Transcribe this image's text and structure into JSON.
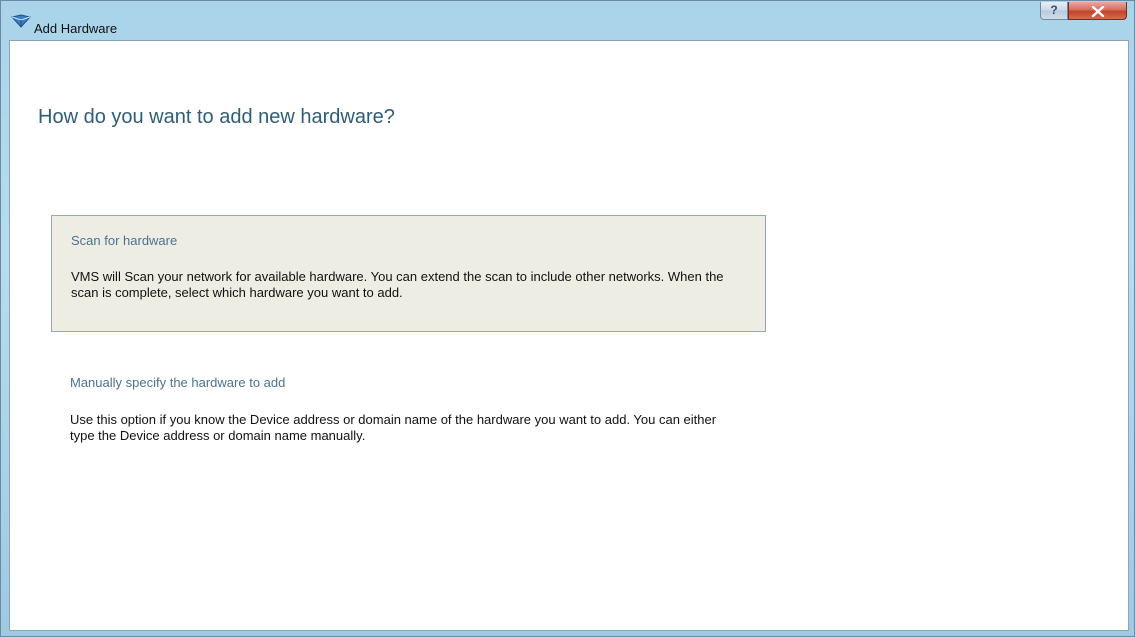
{
  "window": {
    "title": "Add Hardware",
    "help_glyph": "?",
    "icons": {
      "app": "hardware-app-icon",
      "help": "help-icon",
      "close": "close-icon"
    }
  },
  "page": {
    "heading": "How do you want to add new hardware?"
  },
  "options": [
    {
      "title": "Scan for hardware",
      "description": "VMS will Scan your network for available hardware. You can extend the scan to include other networks. When the scan is complete, select which hardware you want to add.",
      "selected": true
    },
    {
      "title": "Manually specify the hardware to add",
      "description": "Use this option if you know the Device address or domain name of the hardware you want to add. You can either type the Device address or domain name manually.",
      "selected": false
    }
  ],
  "colors": {
    "heading": "#2f5d78",
    "option_title": "#4a7390",
    "selected_background": "#eeede4",
    "selected_border": "#89acc4"
  }
}
